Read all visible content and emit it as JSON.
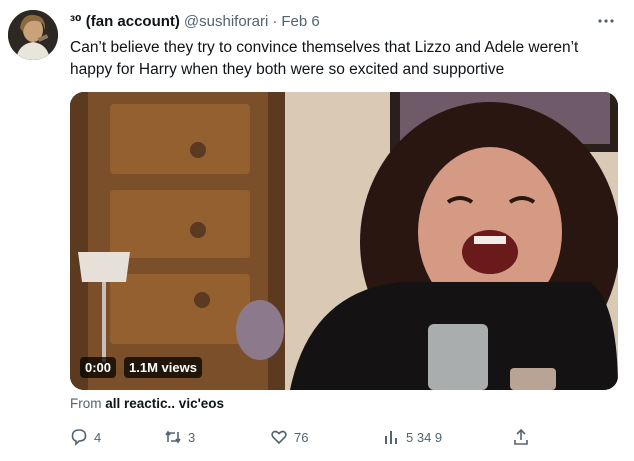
{
  "tweet": {
    "display_name": "³⁰ (fan account)",
    "handle": "@sushiforari",
    "separator": "·",
    "date": "Feb 6",
    "text": "Can’t believe they try to convince themselves that Lizzo and Adele weren’t happy for Harry when they both were so excited and supportive"
  },
  "video": {
    "time": "0:00",
    "views": "1.1M views"
  },
  "source": {
    "prefix": "From",
    "link": "all reactic.. vic'eos"
  },
  "actions": {
    "replies": "4",
    "retweets": "3",
    "likes": "76",
    "views": "5 34 9"
  },
  "icons": {
    "more": "more-dots-icon",
    "reply": "reply-bubble-icon",
    "retweet": "retweet-arrows-icon",
    "like": "heart-icon",
    "views": "analytics-bars-icon",
    "share": "share-upload-icon"
  },
  "colors": {
    "text_primary": "#0f1419",
    "text_secondary": "#536471"
  }
}
